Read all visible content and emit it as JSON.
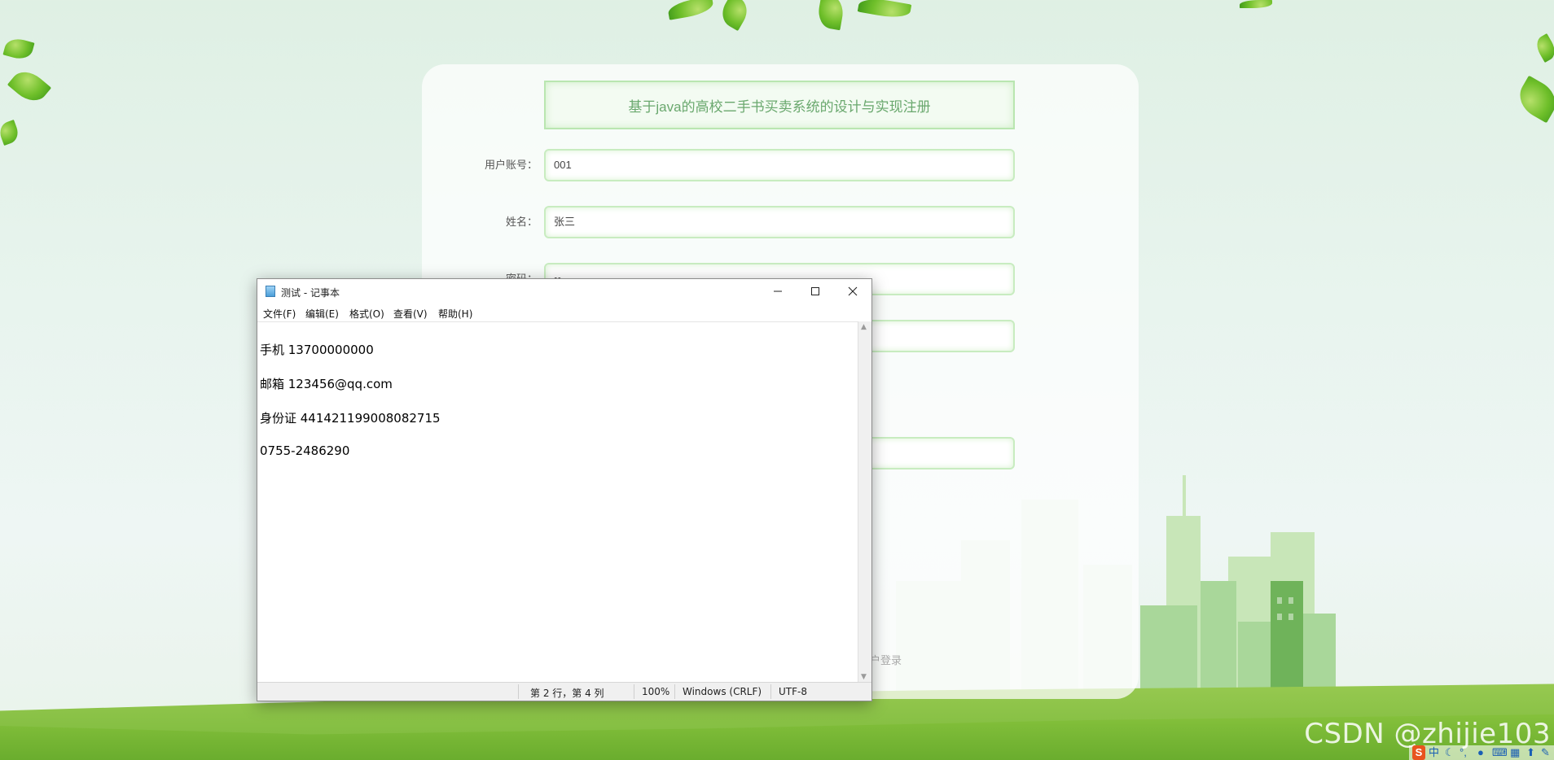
{
  "colors": {
    "card_title_text": "#6aa86e",
    "input_border": "#c8ecc0",
    "ground": "#8cc63f"
  },
  "register_form": {
    "title": "基于java的高校二手书买卖系统的设计与实现注册",
    "account_label": "用户账号：",
    "account_value": "001",
    "name_label": "姓名：",
    "name_value": "张三",
    "password_label": "密码：",
    "password_value": "••",
    "login_link": "户登录"
  },
  "notepad": {
    "title": "测试 - 记事本",
    "icon": "notepad-icon",
    "menus": [
      "文件(F)",
      "编辑(E)",
      "格式(O)",
      "查看(V)",
      "帮助(H)"
    ],
    "lines": [
      "手机 13700000000",
      "邮箱 123456@qq.com",
      "身份证 441421199008082715",
      "0755-2486290"
    ],
    "status": {
      "position": "第 2 行，第 4 列",
      "zoom": "100%",
      "line_ending": "Windows (CRLF)",
      "encoding": "UTF-8"
    }
  },
  "watermark": "CSDN @zhijie103",
  "ime": {
    "logo": "S",
    "mode": "中"
  }
}
